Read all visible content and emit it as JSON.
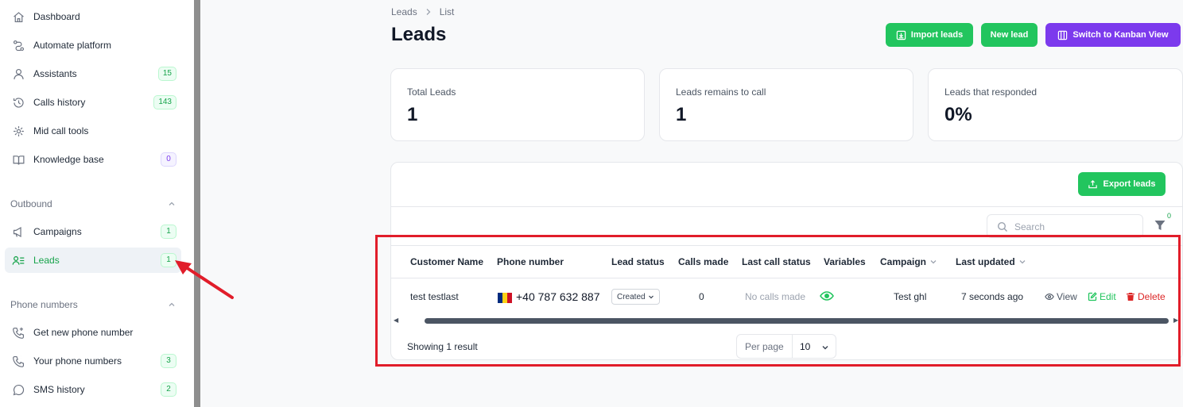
{
  "sidebar": {
    "items": [
      {
        "label": "Dashboard",
        "icon": "home-icon"
      },
      {
        "label": "Automate platform",
        "icon": "workflow-icon"
      },
      {
        "label": "Assistants",
        "icon": "user-icon",
        "badge": "15"
      },
      {
        "label": "Calls history",
        "icon": "history-icon",
        "badge": "143"
      },
      {
        "label": "Mid call tools",
        "icon": "tools-icon"
      },
      {
        "label": "Knowledge base",
        "icon": "book-icon",
        "badge": "0"
      }
    ],
    "sections": {
      "outbound": {
        "title": "Outbound",
        "items": [
          {
            "label": "Campaigns",
            "icon": "megaphone-icon",
            "badge": "1"
          },
          {
            "label": "Leads",
            "icon": "leads-icon",
            "badge": "1"
          }
        ]
      },
      "phone_numbers": {
        "title": "Phone numbers",
        "items": [
          {
            "label": "Get new phone number",
            "icon": "phone-plus-icon"
          },
          {
            "label": "Your phone numbers",
            "icon": "phone-grid-icon",
            "badge": "3"
          },
          {
            "label": "SMS history",
            "icon": "chat-icon",
            "badge": "2"
          }
        ]
      }
    }
  },
  "breadcrumb": {
    "first": "Leads",
    "second": "List"
  },
  "page": {
    "title": "Leads"
  },
  "toolbar": {
    "import_label": "Import leads",
    "new_label": "New lead",
    "kanban_label": "Switch to Kanban View",
    "export_label": "Export leads"
  },
  "stats": [
    {
      "label": "Total Leads",
      "value": "1"
    },
    {
      "label": "Leads remains to call",
      "value": "1"
    },
    {
      "label": "Leads that responded",
      "value": "0%"
    }
  ],
  "search": {
    "placeholder": "Search"
  },
  "filter": {
    "count": "0"
  },
  "table": {
    "columns": [
      "Customer Name",
      "Phone number",
      "Lead status",
      "Calls made",
      "Last call status",
      "Variables",
      "Campaign",
      "Last updated"
    ],
    "rows": [
      {
        "customer_name": "test testlast",
        "phone": "+40 787 632 887",
        "lead_status": "Created",
        "calls_made": "0",
        "last_call_status": "No calls made",
        "campaign": "Test ghl",
        "last_updated": "7 seconds ago",
        "actions": {
          "view": "View",
          "edit": "Edit",
          "delete": "Delete"
        }
      }
    ]
  },
  "footer": {
    "showing": "Showing 1 result",
    "per_page_label": "Per page",
    "per_page_value": "10"
  },
  "colors": {
    "brand_green": "#22c55e",
    "accent_purple": "#7c3aed",
    "delete_red": "#dc2626",
    "highlight_red": "#e11d2a"
  }
}
